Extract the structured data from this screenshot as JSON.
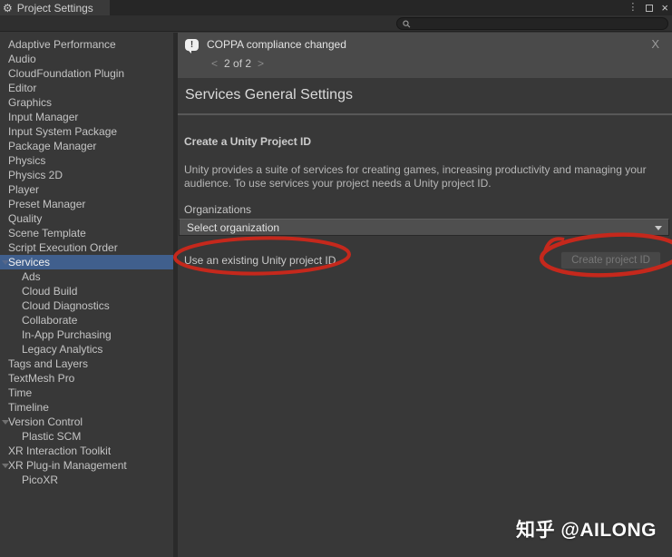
{
  "window": {
    "title": "Project Settings",
    "controls": {
      "menu_icon": "⋮",
      "close_icon": "×"
    }
  },
  "search": {
    "value": "",
    "placeholder": ""
  },
  "sidebar": {
    "items": [
      {
        "label": "Adaptive Performance",
        "indent": 0,
        "foldout": false,
        "selected": false
      },
      {
        "label": "Audio",
        "indent": 0,
        "foldout": false,
        "selected": false
      },
      {
        "label": "CloudFoundation Plugin",
        "indent": 0,
        "foldout": false,
        "selected": false
      },
      {
        "label": "Editor",
        "indent": 0,
        "foldout": false,
        "selected": false
      },
      {
        "label": "Graphics",
        "indent": 0,
        "foldout": false,
        "selected": false
      },
      {
        "label": "Input Manager",
        "indent": 0,
        "foldout": false,
        "selected": false
      },
      {
        "label": "Input System Package",
        "indent": 0,
        "foldout": false,
        "selected": false
      },
      {
        "label": "Package Manager",
        "indent": 0,
        "foldout": false,
        "selected": false
      },
      {
        "label": "Physics",
        "indent": 0,
        "foldout": false,
        "selected": false
      },
      {
        "label": "Physics 2D",
        "indent": 0,
        "foldout": false,
        "selected": false
      },
      {
        "label": "Player",
        "indent": 0,
        "foldout": false,
        "selected": false
      },
      {
        "label": "Preset Manager",
        "indent": 0,
        "foldout": false,
        "selected": false
      },
      {
        "label": "Quality",
        "indent": 0,
        "foldout": false,
        "selected": false
      },
      {
        "label": "Scene Template",
        "indent": 0,
        "foldout": false,
        "selected": false
      },
      {
        "label": "Script Execution Order",
        "indent": 0,
        "foldout": false,
        "selected": false
      },
      {
        "label": "Services",
        "indent": 0,
        "foldout": true,
        "selected": true
      },
      {
        "label": "Ads",
        "indent": 1,
        "foldout": false,
        "selected": false
      },
      {
        "label": "Cloud Build",
        "indent": 1,
        "foldout": false,
        "selected": false
      },
      {
        "label": "Cloud Diagnostics",
        "indent": 1,
        "foldout": false,
        "selected": false
      },
      {
        "label": "Collaborate",
        "indent": 1,
        "foldout": false,
        "selected": false
      },
      {
        "label": "In-App Purchasing",
        "indent": 1,
        "foldout": false,
        "selected": false
      },
      {
        "label": "Legacy Analytics",
        "indent": 1,
        "foldout": false,
        "selected": false
      },
      {
        "label": "Tags and Layers",
        "indent": 0,
        "foldout": false,
        "selected": false
      },
      {
        "label": "TextMesh Pro",
        "indent": 0,
        "foldout": false,
        "selected": false
      },
      {
        "label": "Time",
        "indent": 0,
        "foldout": false,
        "selected": false
      },
      {
        "label": "Timeline",
        "indent": 0,
        "foldout": false,
        "selected": false
      },
      {
        "label": "Version Control",
        "indent": 0,
        "foldout": true,
        "selected": false
      },
      {
        "label": "Plastic SCM",
        "indent": 1,
        "foldout": false,
        "selected": false
      },
      {
        "label": "XR Interaction Toolkit",
        "indent": 0,
        "foldout": false,
        "selected": false
      },
      {
        "label": "XR Plug-in Management",
        "indent": 0,
        "foldout": true,
        "selected": false
      },
      {
        "label": "PicoXR",
        "indent": 1,
        "foldout": false,
        "selected": false
      }
    ]
  },
  "notification": {
    "message": "COPPA compliance changed",
    "prev_label": "<",
    "pager_label": "2 of 2",
    "next_label": ">",
    "close_label": "X"
  },
  "main": {
    "title": "Services General Settings",
    "section_heading": "Create a Unity Project ID",
    "description_lines": [
      "Unity provides a suite of services for creating games, increasing productivity and managing your",
      "audience. To use services your project needs a Unity project ID."
    ],
    "organizations_label": "Organizations",
    "organizations_value": "Select organization",
    "link_label": "Use an existing Unity project ID",
    "create_button_label": "Create project ID"
  },
  "watermark": "知乎 @AILONG",
  "colors": {
    "selection_blue": "#405f8d",
    "annotation_red": "#c5281c",
    "notification_bg": "#4a4a4a",
    "panel_bg": "#383838"
  }
}
